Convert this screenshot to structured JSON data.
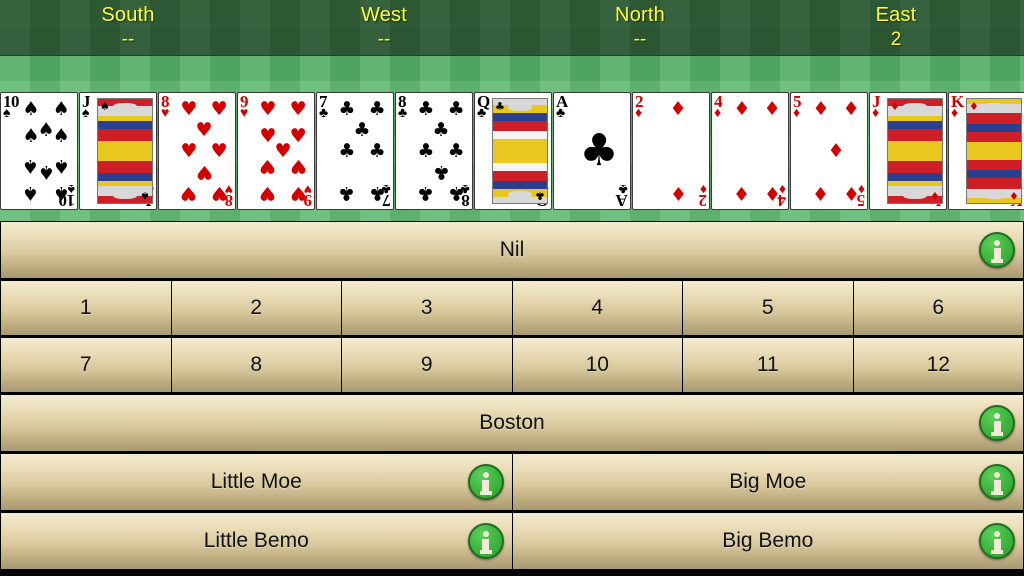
{
  "header": {
    "seats": [
      {
        "name": "South",
        "value": "--"
      },
      {
        "name": "West",
        "value": "--"
      },
      {
        "name": "North",
        "value": "--"
      },
      {
        "name": "East",
        "value": "2"
      }
    ]
  },
  "hand": {
    "cards": [
      {
        "rank": "10",
        "suit": "spades",
        "symbol": "♠",
        "color": "black"
      },
      {
        "rank": "J",
        "suit": "spades",
        "symbol": "♠",
        "color": "black"
      },
      {
        "rank": "8",
        "suit": "hearts",
        "symbol": "♥",
        "color": "red"
      },
      {
        "rank": "9",
        "suit": "hearts",
        "symbol": "♥",
        "color": "red"
      },
      {
        "rank": "7",
        "suit": "clubs",
        "symbol": "♣",
        "color": "black"
      },
      {
        "rank": "8",
        "suit": "clubs",
        "symbol": "♣",
        "color": "black"
      },
      {
        "rank": "Q",
        "suit": "clubs",
        "symbol": "♣",
        "color": "black"
      },
      {
        "rank": "A",
        "suit": "clubs",
        "symbol": "♣",
        "color": "black"
      },
      {
        "rank": "2",
        "suit": "diamonds",
        "symbol": "♦",
        "color": "red"
      },
      {
        "rank": "4",
        "suit": "diamonds",
        "symbol": "♦",
        "color": "red"
      },
      {
        "rank": "5",
        "suit": "diamonds",
        "symbol": "♦",
        "color": "red"
      },
      {
        "rank": "J",
        "suit": "diamonds",
        "symbol": "♦",
        "color": "red"
      },
      {
        "rank": "K",
        "suit": "diamonds",
        "symbol": "♦",
        "color": "red"
      }
    ]
  },
  "bidding": {
    "nil_label": "Nil",
    "numbers_row1": [
      "1",
      "2",
      "3",
      "4",
      "5",
      "6"
    ],
    "numbers_row2": [
      "7",
      "8",
      "9",
      "10",
      "11",
      "12"
    ],
    "boston_label": "Boston",
    "special": [
      {
        "left": "Little Moe",
        "right": "Big Moe"
      },
      {
        "left": "Little Bemo",
        "right": "Big Bemo"
      }
    ],
    "info_icon": "info-icon"
  },
  "colors": {
    "seat_text": "#ffff33",
    "header_felt": "#27572f",
    "table_felt": "#55b268",
    "button_top": "#f3ebd2",
    "button_bottom": "#a89a74",
    "info_green": "#3fb83f",
    "card_red": "#d40000"
  }
}
